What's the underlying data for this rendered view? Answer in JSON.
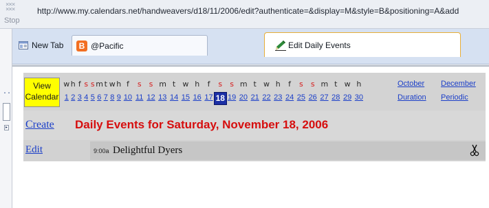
{
  "browser": {
    "stop_label": "Stop",
    "stop_icon": "stop-icon",
    "address_url": "http://www.my.calendars.net/handweavers/d18/11/2006/edit?authenticate=&display=M&style=B&positioning=A&add"
  },
  "tabs": [
    {
      "label": "New Tab",
      "icon": "new-tab-icon"
    },
    {
      "label": "@Pacific",
      "icon": "blogger-icon",
      "icon_glyph": "B"
    },
    {
      "label": "Edit Daily Events",
      "icon": "edit-pencil-icon",
      "active": true
    }
  ],
  "calendar": {
    "view_button": "View Calendar",
    "view_button_line1": "View",
    "view_button_line2": "Calendar",
    "day_letters": [
      "w",
      "h",
      "f",
      "s",
      "s",
      "m",
      "t",
      "w",
      "h",
      "f",
      "s",
      "s",
      "m",
      "t",
      "w",
      "h",
      "f",
      "s",
      "s",
      "m",
      "t",
      "w",
      "h",
      "f",
      "s",
      "s",
      "m",
      "t",
      "w",
      "h"
    ],
    "weekend_color": "#d61a1a",
    "weekday_color": "#2a2a2a",
    "days": [
      "1",
      "2",
      "3",
      "4",
      "5",
      "6",
      "7",
      "8",
      "9",
      "10",
      "11",
      "12",
      "13",
      "14",
      "15",
      "16",
      "17",
      "18",
      "19",
      "20",
      "21",
      "22",
      "23",
      "24",
      "25",
      "26",
      "27",
      "28",
      "29",
      "30"
    ],
    "selected_day": "18",
    "link_color": "#1a3ec8",
    "side_links": {
      "prev_month": "October",
      "next_month": "December",
      "duration": "Duration",
      "periodic": "Periodic"
    }
  },
  "heading": {
    "create_link": "Create",
    "title": "Daily Events for Saturday, November 18, 2006",
    "title_color": "#d60e0e"
  },
  "events": [
    {
      "edit_link": "Edit",
      "time": "9:00a",
      "title": "Delightful Dyers",
      "action_icon": "scissors-icon"
    }
  ]
}
